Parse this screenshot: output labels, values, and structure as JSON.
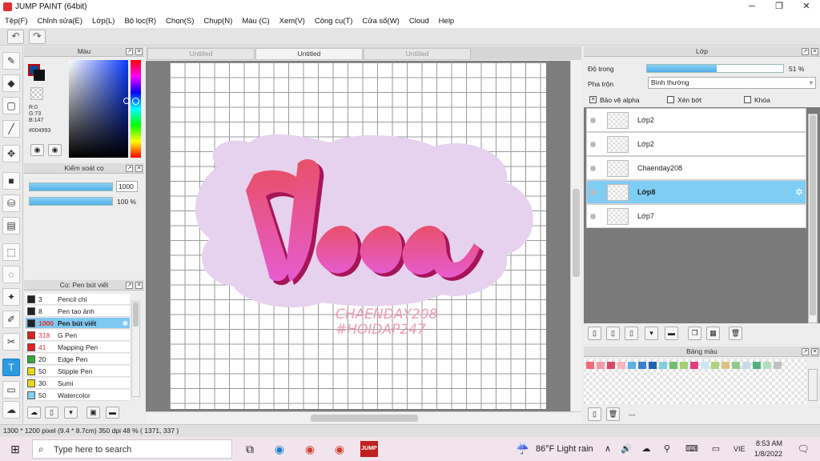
{
  "window": {
    "title": "JUMP PAINT (64bit)",
    "min": "─",
    "max": "❐",
    "close": "✕"
  },
  "menu": [
    "Tệp(F)",
    "Chỉnh sửa(E)",
    "Lớp(L)",
    "Bộ lọc(R)",
    "Chọn(S)",
    "Chụp(N)",
    "Màu (C)",
    "Xem(V)",
    "Công cụ(T)",
    "Cửa sổ(W)",
    "Cloud",
    "Help"
  ],
  "color_panel": {
    "title": "Màu",
    "r": "R:0",
    "g": "G:73",
    "b": "B:147",
    "hex": "#004993",
    "fg_color": "#004993"
  },
  "brush_control": {
    "title": "Kiểm soát cọ",
    "size_value": "1000",
    "opacity_value": "100 %",
    "opacity_fraction": 1.0
  },
  "brush_list": {
    "title": "Cọ: Pen bút viết",
    "items": [
      {
        "size": "3",
        "name": "Pencil chì",
        "color": "#222222"
      },
      {
        "size": "8",
        "name": "Pen tạo ảnh",
        "color": "#222222"
      },
      {
        "size": "1000",
        "name": "Pen bút viết",
        "color": "#222222",
        "selected": true
      },
      {
        "size": "318",
        "name": "G Pen",
        "color": "#e02020"
      },
      {
        "size": "41",
        "name": "Mapping Pen",
        "color": "#e02020"
      },
      {
        "size": "20",
        "name": "Edge Pen",
        "color": "#33aa33"
      },
      {
        "size": "50",
        "name": "Stipple Pen",
        "color": "#e8d81c"
      },
      {
        "size": "30",
        "name": "Sumi",
        "color": "#e8d81c"
      },
      {
        "size": "50",
        "name": "Watercolor",
        "color": "#7fd0f0"
      }
    ]
  },
  "tabs": [
    "Untitled",
    "Untitled",
    "Untitled"
  ],
  "canvas": {
    "watermark_line1": "CHAENDAY208",
    "watermark_line2": "#HOIDAP247"
  },
  "layer_panel": {
    "title": "Lớp",
    "opacity_label": "Độ trong",
    "opacity_value": "51 %",
    "opacity_fraction": 0.51,
    "blend_label": "Pha trộn",
    "blend_value": "Bình thường",
    "protect_alpha": "Bảo vệ alpha",
    "clipping": "Xén bớt",
    "lock": "Khóa",
    "layers": [
      {
        "name": "Lớp2"
      },
      {
        "name": "Lớp2"
      },
      {
        "name": "Chaenday208"
      },
      {
        "name": "Lớp8",
        "selected": true
      },
      {
        "name": "Lớp7"
      }
    ]
  },
  "swatch_panel": {
    "title": "Bảng màu",
    "dash": "---",
    "colors": [
      "#f26b7a",
      "#f29aa8",
      "#d94a6a",
      "#f5b6c0",
      "#5fb0e8",
      "#3b7fd0",
      "#1f5fb0",
      "#7fcfe0",
      "#70c070",
      "#a0d070",
      "#e04080",
      "#c8e8f8",
      "#b0d080",
      "#e0c080",
      "#90c890",
      "#c8d8e8",
      "#50b080",
      "#b0e0c0",
      "#c0c0c0"
    ]
  },
  "status": {
    "text": "1300 * 1200 pixel  (9.4 * 8.7cm)  350 dpi  48 %  ( 1371, 337 )"
  },
  "taskbar": {
    "search_placeholder": "Type here to search",
    "weather": "86°F  Light rain",
    "lang": "VIE",
    "time": "8:53 AM",
    "date": "1/8/2022",
    "jump_label": "JUMP"
  }
}
